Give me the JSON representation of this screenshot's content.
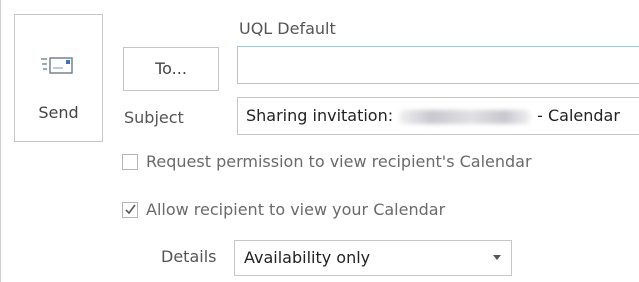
{
  "compose": {
    "send_label": "Send",
    "from_account": "UQL Default",
    "to_button_label": "To...",
    "to_value": "",
    "subject_label": "Subject",
    "subject_prefix": "Sharing invitation:",
    "subject_suffix": "- Calendar"
  },
  "options": {
    "request_permission": {
      "label": "Request permission to view recipient's Calendar",
      "checked": false
    },
    "allow_view": {
      "label": "Allow recipient to view your Calendar",
      "checked": true
    }
  },
  "details": {
    "label": "Details",
    "selected": "Availability only"
  },
  "icons": {
    "send": "send-envelope-icon",
    "dropdown": "chevron-down-icon",
    "check": "checkmark-icon"
  }
}
